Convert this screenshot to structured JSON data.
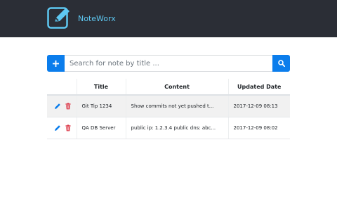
{
  "header": {
    "brand": "NoteWorx",
    "logo_icon": "edit-note-icon",
    "background_color": "#2b2e36",
    "brand_color": "#5ec8f2"
  },
  "search": {
    "placeholder": "Search for note by title ...",
    "value": "",
    "add_icon": "plus-icon",
    "search_icon": "search-icon",
    "accent_color": "#0b7dec"
  },
  "table": {
    "columns": [
      "",
      "Title",
      "Content",
      "Updated Date"
    ],
    "rows": [
      {
        "title": "Git Tip 1234",
        "content": "Show commits not yet pushed t...",
        "updated": "2017-12-09 08:13",
        "edit_icon": "pencil-icon",
        "delete_icon": "trash-icon"
      },
      {
        "title": "QA DB Server",
        "content": "public ip: 1.2.3.4 public dns: abc...",
        "updated": "2017-12-09 08:02",
        "edit_icon": "pencil-icon",
        "delete_icon": "trash-icon"
      }
    ],
    "edit_color": "#0b7dec",
    "delete_color": "#dc3545"
  }
}
